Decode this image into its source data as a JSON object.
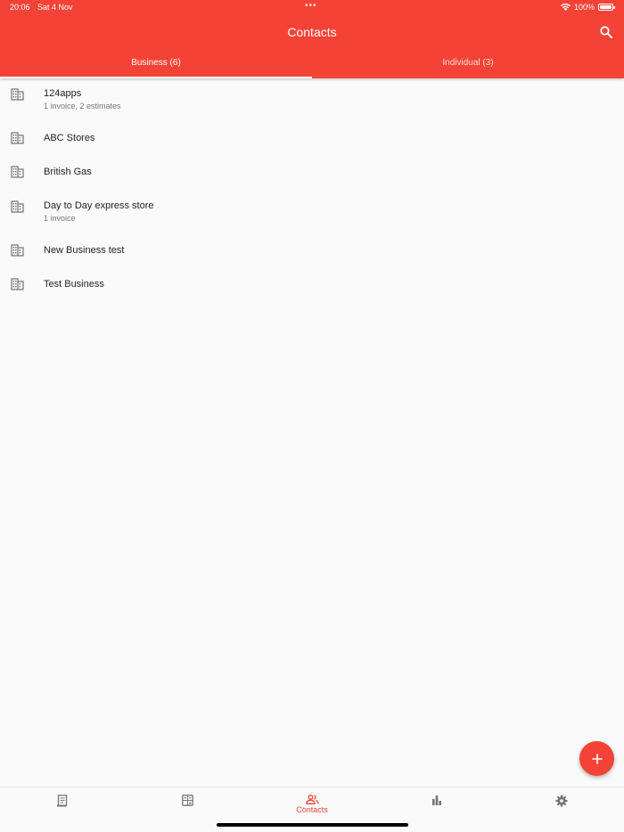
{
  "status_bar": {
    "time": "20:06",
    "date": "Sat 4 Nov",
    "battery": "100%"
  },
  "header": {
    "title": "Contacts",
    "search_icon": "search-icon"
  },
  "tabs": [
    {
      "label": "Business (6)",
      "active": true
    },
    {
      "label": "Individual (3)",
      "active": false
    }
  ],
  "contacts": [
    {
      "name": "124apps",
      "detail": "1 invoice, 2 estimates",
      "icon": "building-icon"
    },
    {
      "name": "ABC Stores",
      "detail": "",
      "icon": "building-icon"
    },
    {
      "name": "British Gas",
      "detail": "",
      "icon": "building-icon"
    },
    {
      "name": "Day to Day express store",
      "detail": "1 invoice",
      "icon": "building-icon"
    },
    {
      "name": "New Business test",
      "detail": "",
      "icon": "building-icon"
    },
    {
      "name": "Test Business",
      "detail": "",
      "icon": "building-icon"
    }
  ],
  "fab": {
    "icon": "plus-icon"
  },
  "bottom_nav": [
    {
      "icon": "invoice-icon",
      "label": "",
      "active": false
    },
    {
      "icon": "estimate-icon",
      "label": "",
      "active": false
    },
    {
      "icon": "contacts-icon",
      "label": "Contacts",
      "active": true
    },
    {
      "icon": "bar-chart-icon",
      "label": "",
      "active": false
    },
    {
      "icon": "gear-icon",
      "label": "",
      "active": false
    }
  ],
  "colors": {
    "primary": "#f44336",
    "icon_gray": "#757575"
  }
}
